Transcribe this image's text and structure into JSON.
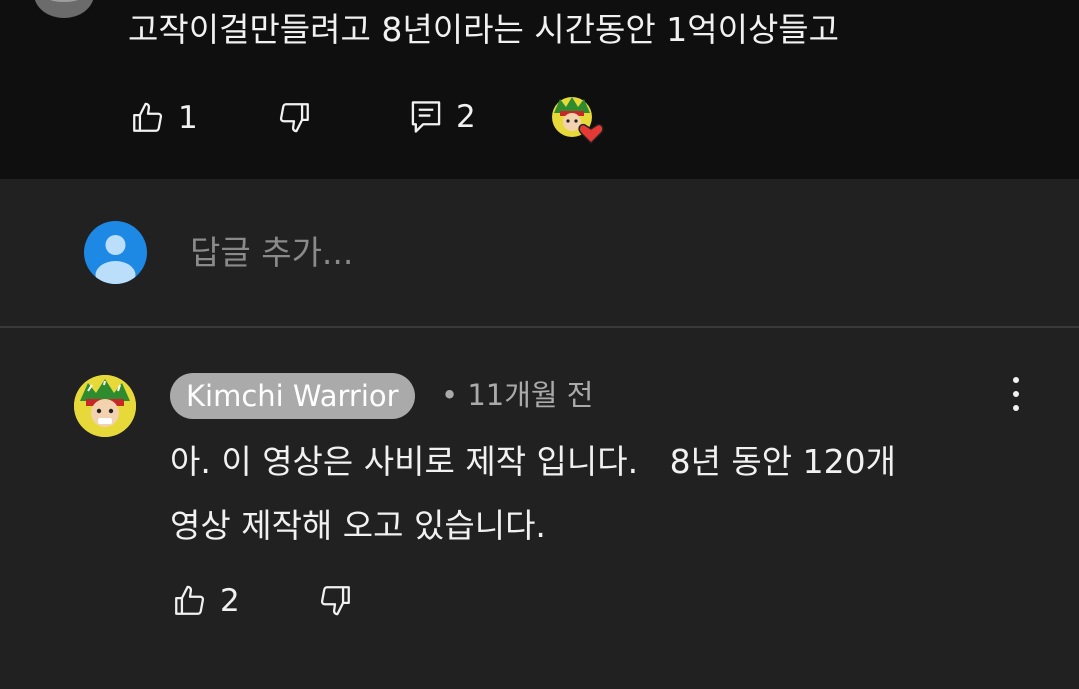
{
  "parent_comment": {
    "text": "고작이걸만들려고 8년이라는 시간동안 1억이상들고",
    "like_count": "1",
    "reply_count": "2",
    "icons": [
      "thumb-up-icon",
      "thumb-down-icon",
      "reply-icon",
      "creator-heart-icon"
    ]
  },
  "reply_input": {
    "placeholder": "답글 추가..."
  },
  "reply_comment": {
    "author": "Kimchi Warrior",
    "separator": "•",
    "time": "11개월 전",
    "lines": [
      "아. 이 영상은 사비로 제작 입니다.   8년 동안 120개",
      "영상 제작해 오고 있습니다."
    ],
    "like_count": "2",
    "icons": [
      "thumb-up-icon",
      "thumb-down-icon",
      "more-vert-icon"
    ]
  },
  "colors": {
    "top_background": "#0f0f0f",
    "panel_background": "#212121",
    "author_chip": "#aaaaaa",
    "user_avatar": "#1e88e5",
    "heart": "#e53935"
  }
}
